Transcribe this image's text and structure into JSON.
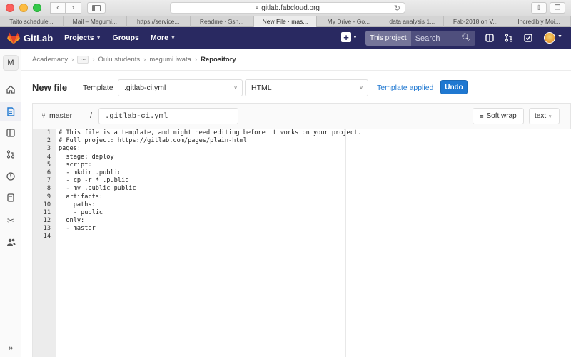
{
  "browser": {
    "url": "gitlab.fabcloud.org",
    "tabs": [
      {
        "label": "Taito schedule..."
      },
      {
        "label": "Mail – Megumi..."
      },
      {
        "label": "https://service..."
      },
      {
        "label": "Readme · Ssh..."
      },
      {
        "label": "New File · mas...",
        "active": true
      },
      {
        "label": "My Drive - Go..."
      },
      {
        "label": "data analysis 1..."
      },
      {
        "label": "Fab-2018 on V..."
      },
      {
        "label": "Incredibly Moi..."
      }
    ]
  },
  "topnav": {
    "brand": "GitLab",
    "projects": "Projects",
    "groups": "Groups",
    "more": "More",
    "search_scope": "This project",
    "search_placeholder": "Search",
    "bg_color": "#292961"
  },
  "sidebar": {
    "project_initial": "M",
    "icons": [
      "home-icon",
      "repository-icon",
      "issues-board-icon",
      "merge-request-icon",
      "issues-icon",
      "snippets-icon",
      "scissors-icon",
      "members-icon",
      "expand-icon"
    ]
  },
  "breadcrumb": {
    "items": [
      "Academany",
      "Oulu students",
      "megumi.iwata",
      "Repository"
    ]
  },
  "header": {
    "title": "New file",
    "template_label": "Template",
    "template_value": ".gitlab-ci.yml",
    "type_value": "HTML",
    "template_applied": "Template applied",
    "undo": "Undo",
    "accent": "#1f78d1"
  },
  "filebar": {
    "branch": "master",
    "separator": "/",
    "filename": ".gitlab-ci.yml",
    "soft_wrap": "Soft wrap",
    "mode": "text"
  },
  "editor": {
    "lines": [
      {
        "n": "1",
        "text": "# This file is a template, and might need editing before it works on your project."
      },
      {
        "n": "2",
        "text": "# Full project: https://gitlab.com/pages/plain-html"
      },
      {
        "n": "3",
        "text": "pages:"
      },
      {
        "n": "4",
        "text": "  stage: deploy"
      },
      {
        "n": "5",
        "text": "  script:"
      },
      {
        "n": "6",
        "text": "  - mkdir .public"
      },
      {
        "n": "7",
        "text": "  - cp -r * .public"
      },
      {
        "n": "8",
        "text": "  - mv .public public"
      },
      {
        "n": "9",
        "text": "  artifacts:"
      },
      {
        "n": "10",
        "text": "    paths:"
      },
      {
        "n": "11",
        "text": "    - public"
      },
      {
        "n": "12",
        "text": "  only:"
      },
      {
        "n": "13",
        "text": "  - master"
      },
      {
        "n": "14",
        "text": ""
      }
    ]
  }
}
